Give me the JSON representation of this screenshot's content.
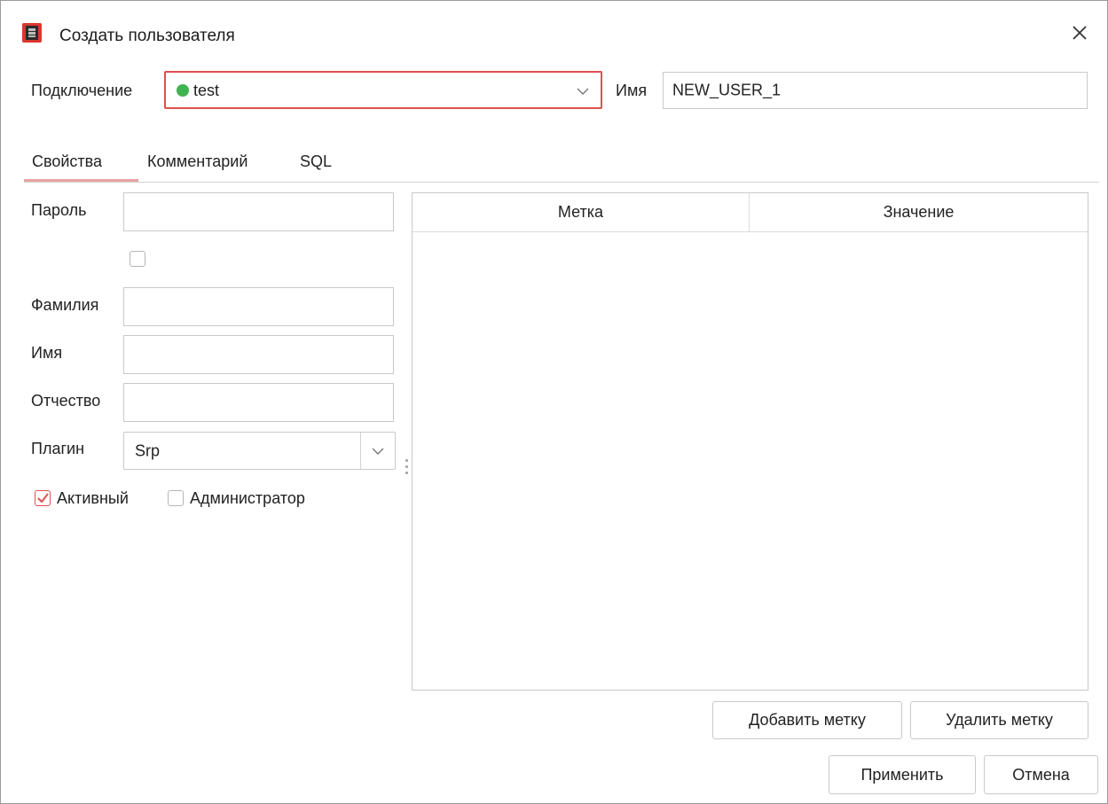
{
  "window": {
    "title": "Создать пользователя",
    "app_icon": "database-app-icon",
    "close_icon": "close-icon"
  },
  "header": {
    "connection_label": "Подключение",
    "connection_value": "test",
    "connection_status_color": "#3fb34f",
    "name_label": "Имя",
    "name_value": "NEW_USER_1"
  },
  "tabs": [
    {
      "label": "Свойства",
      "active": true
    },
    {
      "label": "Комментарий",
      "active": false
    },
    {
      "label": "SQL",
      "active": false
    }
  ],
  "form": {
    "password_label": "Пароль",
    "password_value": "",
    "show_password_checked": false,
    "last_name_label": "Фамилия",
    "first_name_label": "Имя",
    "middle_name_label": "Отчество",
    "plugin_label": "Плагин",
    "plugin_value": "Srp",
    "active_label": "Активный",
    "active_checked": true,
    "admin_label": "Администратор",
    "admin_checked": false
  },
  "tags_table": {
    "columns": [
      "Метка",
      "Значение"
    ],
    "rows": []
  },
  "buttons": {
    "add_tag": "Добавить метку",
    "remove_tag": "Удалить метку",
    "apply": "Применить",
    "cancel": "Отмена"
  },
  "colors": {
    "accent": "#e05050",
    "focus_border": "#e05050",
    "tab_underline": "#e8a4a4",
    "check_mark": "#e05050"
  }
}
